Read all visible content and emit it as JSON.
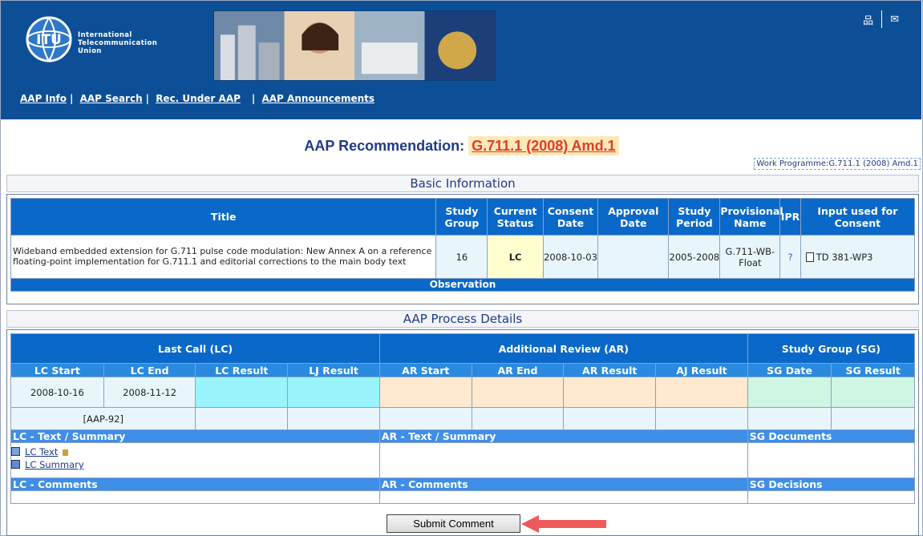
{
  "header": {
    "org_line1": "International",
    "org_line2": "Telecommunication",
    "org_line3": "Union",
    "logo_text": "ITU",
    "nav": [
      "AAP Info",
      "AAP Search",
      "Rec. Under AAP",
      "AAP Announcements"
    ],
    "icons": [
      "sitemap-icon",
      "mail-icon"
    ],
    "sitemap_glyph": "品",
    "mail_glyph": "✉"
  },
  "title": {
    "prefix": "AAP Recommendation:",
    "rec": "G.711.1 (2008) Amd.1",
    "work_programme": "Work Programme:G.711.1 (2008) Amd.1"
  },
  "basic": {
    "section_title": "Basic Information",
    "headers": [
      "Title",
      "Study Group",
      "Current Status",
      "Consent Date",
      "Approval Date",
      "Study Period",
      "Provisional Name",
      "IPR",
      "Input used for Consent"
    ],
    "row": {
      "title": "Wideband embedded extension for G.711 pulse code modulation: New Annex A on a reference floating-point implementation for G.711.1 and editorial corrections to the main body text",
      "study_group": "16",
      "status": "LC",
      "consent_date": "2008-10-03",
      "approval_date": "",
      "study_period": "2005-2008",
      "provisional_name": "G.711-WB-Float",
      "ipr": "?",
      "input": "TD 381-WP3"
    },
    "observation": "Observation"
  },
  "process": {
    "section_title": "AAP Process Details",
    "groups": [
      "Last Call (LC)",
      "Additional Review (AR)",
      "Study Group (SG)"
    ],
    "subheaders": [
      "LC Start",
      "LC End",
      "LC Result",
      "LJ Result",
      "AR Start",
      "AR End",
      "AR Result",
      "AJ Result",
      "SG Date",
      "SG Result"
    ],
    "lc_start": "2008-10-16",
    "lc_end": "2008-11-12",
    "aap_ref": "[AAP-92]",
    "lc_text_summary": "LC - Text / Summary",
    "ar_text_summary": "AR - Text / Summary",
    "sg_documents": "SG Documents",
    "lc_text_link": "LC Text",
    "lc_summary_link": "LC Summary",
    "lc_comments": "LC - Comments",
    "ar_comments": "AR - Comments",
    "sg_decisions": "SG Decisions"
  },
  "submit_label": "Submit Comment",
  "colors": {
    "header_blue": "#0d4f96",
    "table_header": "#0a68c8",
    "accent_red": "#e23b27"
  }
}
